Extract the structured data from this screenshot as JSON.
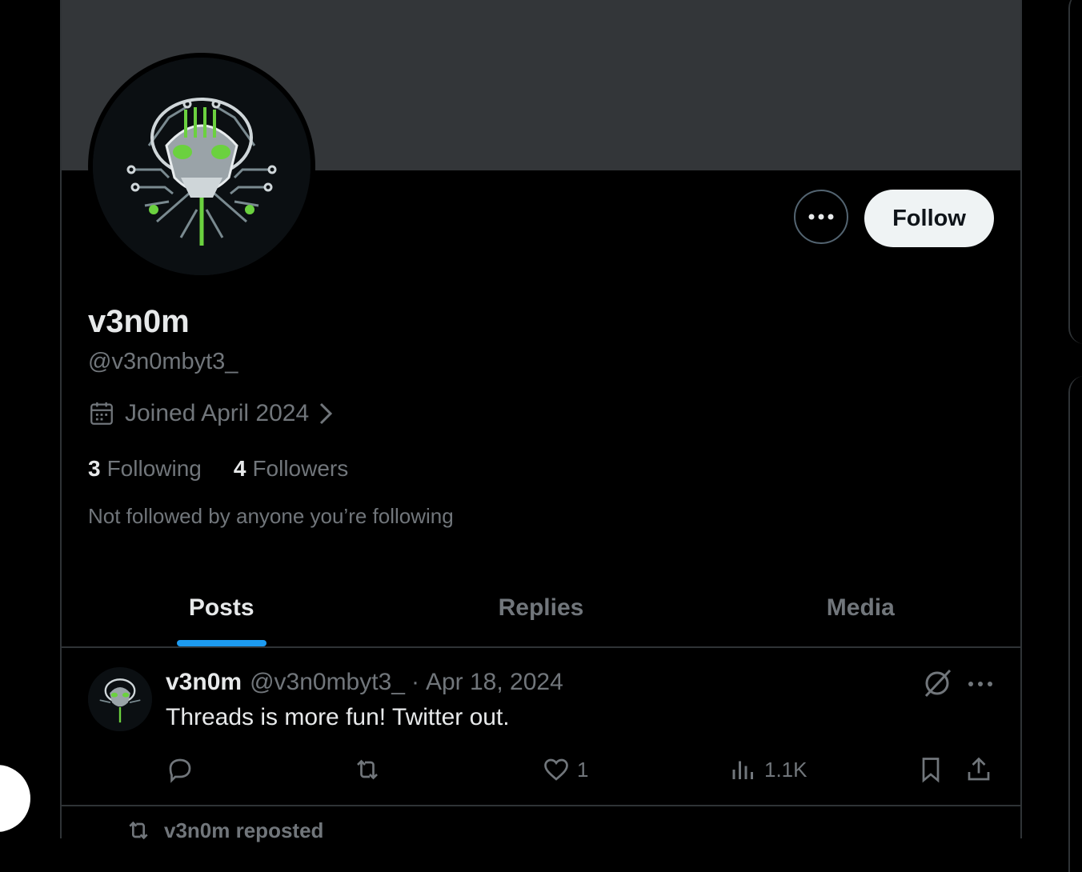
{
  "profile": {
    "display_name": "v3n0m",
    "handle": "@v3n0mbyt3_",
    "joined": "Joined April 2024",
    "following_count": "3",
    "following_label": "Following",
    "followers_count": "4",
    "followers_label": "Followers",
    "not_followed_text": "Not followed by anyone you’re following"
  },
  "actions": {
    "follow_label": "Follow"
  },
  "tabs": [
    {
      "label": "Posts",
      "active": true
    },
    {
      "label": "Replies",
      "active": false
    },
    {
      "label": "Media",
      "active": false
    }
  ],
  "post": {
    "name": "v3n0m",
    "handle": "@v3n0mbyt3_",
    "separator": "·",
    "date": "Apr 18, 2024",
    "text": "Threads is more fun! Twitter out.",
    "likes": "1",
    "views": "1.1K"
  },
  "repost_line": "v3n0m reposted",
  "colors": {
    "background": "#000000",
    "banner": "#333639",
    "accent": "#1d9bf0",
    "secondary_text": "#71767b",
    "avatar_green": "#6bd13f"
  },
  "icons": [
    "calendar-icon",
    "chevron-right-icon",
    "more-icon",
    "grok-icon",
    "reply-icon",
    "repost-icon",
    "like-icon",
    "views-icon",
    "bookmark-icon",
    "share-icon"
  ]
}
